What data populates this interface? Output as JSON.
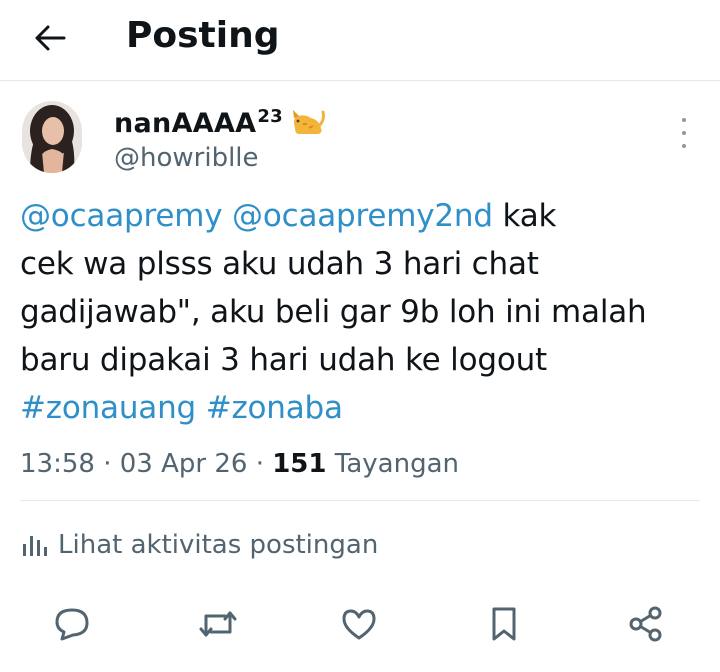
{
  "header": {
    "title": "Posting"
  },
  "post": {
    "display_name": "nanAAAA",
    "name_superscript": "23",
    "name_emoji": "🐈",
    "handle": "@howriblle",
    "lines": [
      [
        {
          "text": "@ocaapremy",
          "link": true
        },
        {
          "text": " ",
          "link": false
        },
        {
          "text": "@ocaapremy2nd",
          "link": true
        },
        {
          "text": " kak",
          "link": false
        }
      ],
      [
        {
          "text": "cek wa plsss aku udah 3 hari chat",
          "link": false
        }
      ],
      [
        {
          "text": "gadijawab\", aku beli gar 9b loh ini malah",
          "link": false
        }
      ],
      [
        {
          "text": "baru dipakai 3 hari udah ke logout",
          "link": false
        }
      ],
      [
        {
          "text": "#zonauang",
          "link": true
        },
        {
          "text": " ",
          "link": false
        },
        {
          "text": "#zonaba",
          "link": true
        }
      ]
    ],
    "time": "13:58",
    "separator": "·",
    "date": "03 Apr 26",
    "views_count": "151",
    "views_label": "Tayangan"
  },
  "activity_label": "Lihat aktivitas postingan",
  "actions": [
    "reply-icon",
    "repost-icon",
    "like-icon",
    "bookmark-icon",
    "share-icon"
  ],
  "colors": {
    "link": "#2f8fc9",
    "muted": "#536471",
    "text": "#0f1419"
  }
}
